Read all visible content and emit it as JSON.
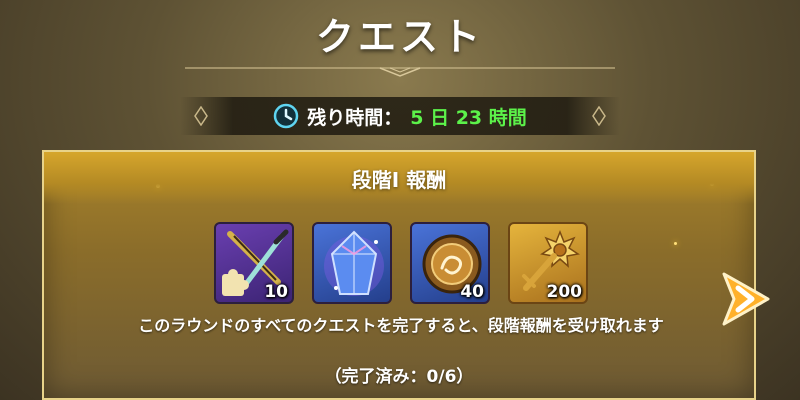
{
  "header": {
    "title": "クエスト"
  },
  "timer": {
    "label": "残り時間：",
    "value": "5 日 23 時間",
    "value_color": "#5cf24a",
    "icon": "clock-icon"
  },
  "panel": {
    "title": "段階I 報酬",
    "rewards": [
      {
        "icon": "weapon-fragment-icon",
        "count": "10"
      },
      {
        "icon": "crystal-icon",
        "count": ""
      },
      {
        "icon": "orb-coin-icon",
        "count": "40"
      },
      {
        "icon": "sun-key-icon",
        "count": "200"
      }
    ],
    "description": "このラウンドのすべてのクエストを完了すると、段階報酬を受け取れます",
    "progress": "（完了済み：0/6）"
  },
  "navigation": {
    "next_icon": "next-arrow-icon"
  }
}
